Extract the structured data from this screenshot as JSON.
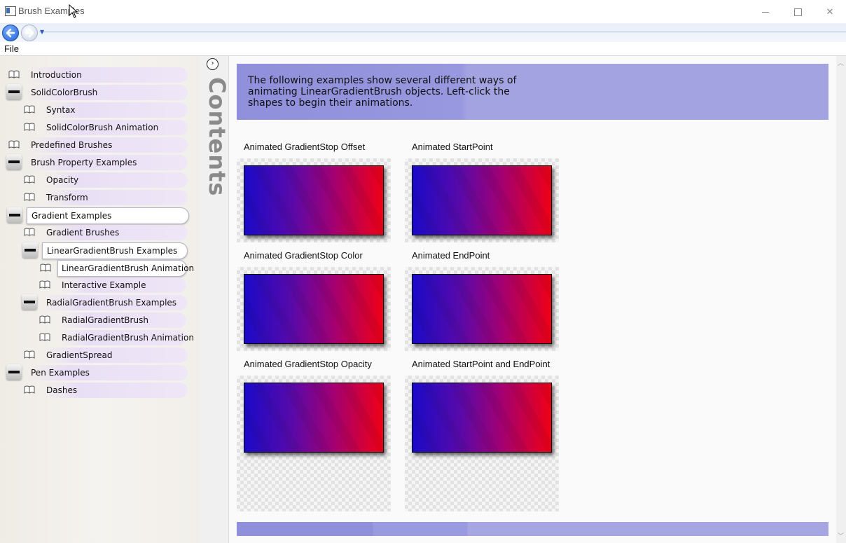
{
  "window": {
    "title": "Brush Examples",
    "minimize_glyph": "",
    "maximize_glyph": "",
    "close_glyph": "✕"
  },
  "menu": {
    "file": "File"
  },
  "sidebar": {
    "items": [
      {
        "label": "Introduction",
        "icon": "book-icon"
      },
      {
        "label": "SolidColorBrush",
        "icon": "folder-icon"
      },
      {
        "label": "Syntax",
        "icon": "book-icon"
      },
      {
        "label": "SolidColorBrush Animation",
        "icon": "book-icon"
      },
      {
        "label": "Predefined Brushes",
        "icon": "book-icon"
      },
      {
        "label": "Brush Property Examples",
        "icon": "folder-icon"
      },
      {
        "label": "Opacity",
        "icon": "book-icon"
      },
      {
        "label": "Transform",
        "icon": "book-icon"
      },
      {
        "label": "Gradient Examples",
        "icon": "folder-icon"
      },
      {
        "label": "Gradient Brushes",
        "icon": "book-icon"
      },
      {
        "label": "LinearGradientBrush Examples",
        "icon": "folder-icon"
      },
      {
        "label": "LinearGradientBrush Animation",
        "icon": "book-icon"
      },
      {
        "label": "Interactive Example",
        "icon": "book-icon"
      },
      {
        "label": "RadialGradientBrush Examples",
        "icon": "folder-icon"
      },
      {
        "label": "RadialGradientBrush",
        "icon": "book-icon"
      },
      {
        "label": "RadialGradientBrush Animation",
        "icon": "book-icon"
      },
      {
        "label": "GradientSpread",
        "icon": "book-icon"
      },
      {
        "label": "Pen Examples",
        "icon": "folder-icon"
      },
      {
        "label": "Dashes",
        "icon": "book-icon"
      }
    ]
  },
  "contents": {
    "label": "Contents",
    "toggle_glyph": "›"
  },
  "main": {
    "intro": "The following examples show several different ways of animating LinearGradientBrush objects. Left-click the shapes to begin their animations.",
    "examples": [
      {
        "title": "Animated GradientStop Offset"
      },
      {
        "title": "Animated StartPoint"
      },
      {
        "title": "Animated GradientStop Color"
      },
      {
        "title": "Animated EndPoint"
      },
      {
        "title": "Animated GradientStop Opacity"
      },
      {
        "title": "Animated StartPoint and EndPoint"
      }
    ]
  },
  "colors": {
    "banner": "#9a9ae0",
    "gradient_start": "#1a0ac8",
    "gradient_end": "#ef0015"
  }
}
